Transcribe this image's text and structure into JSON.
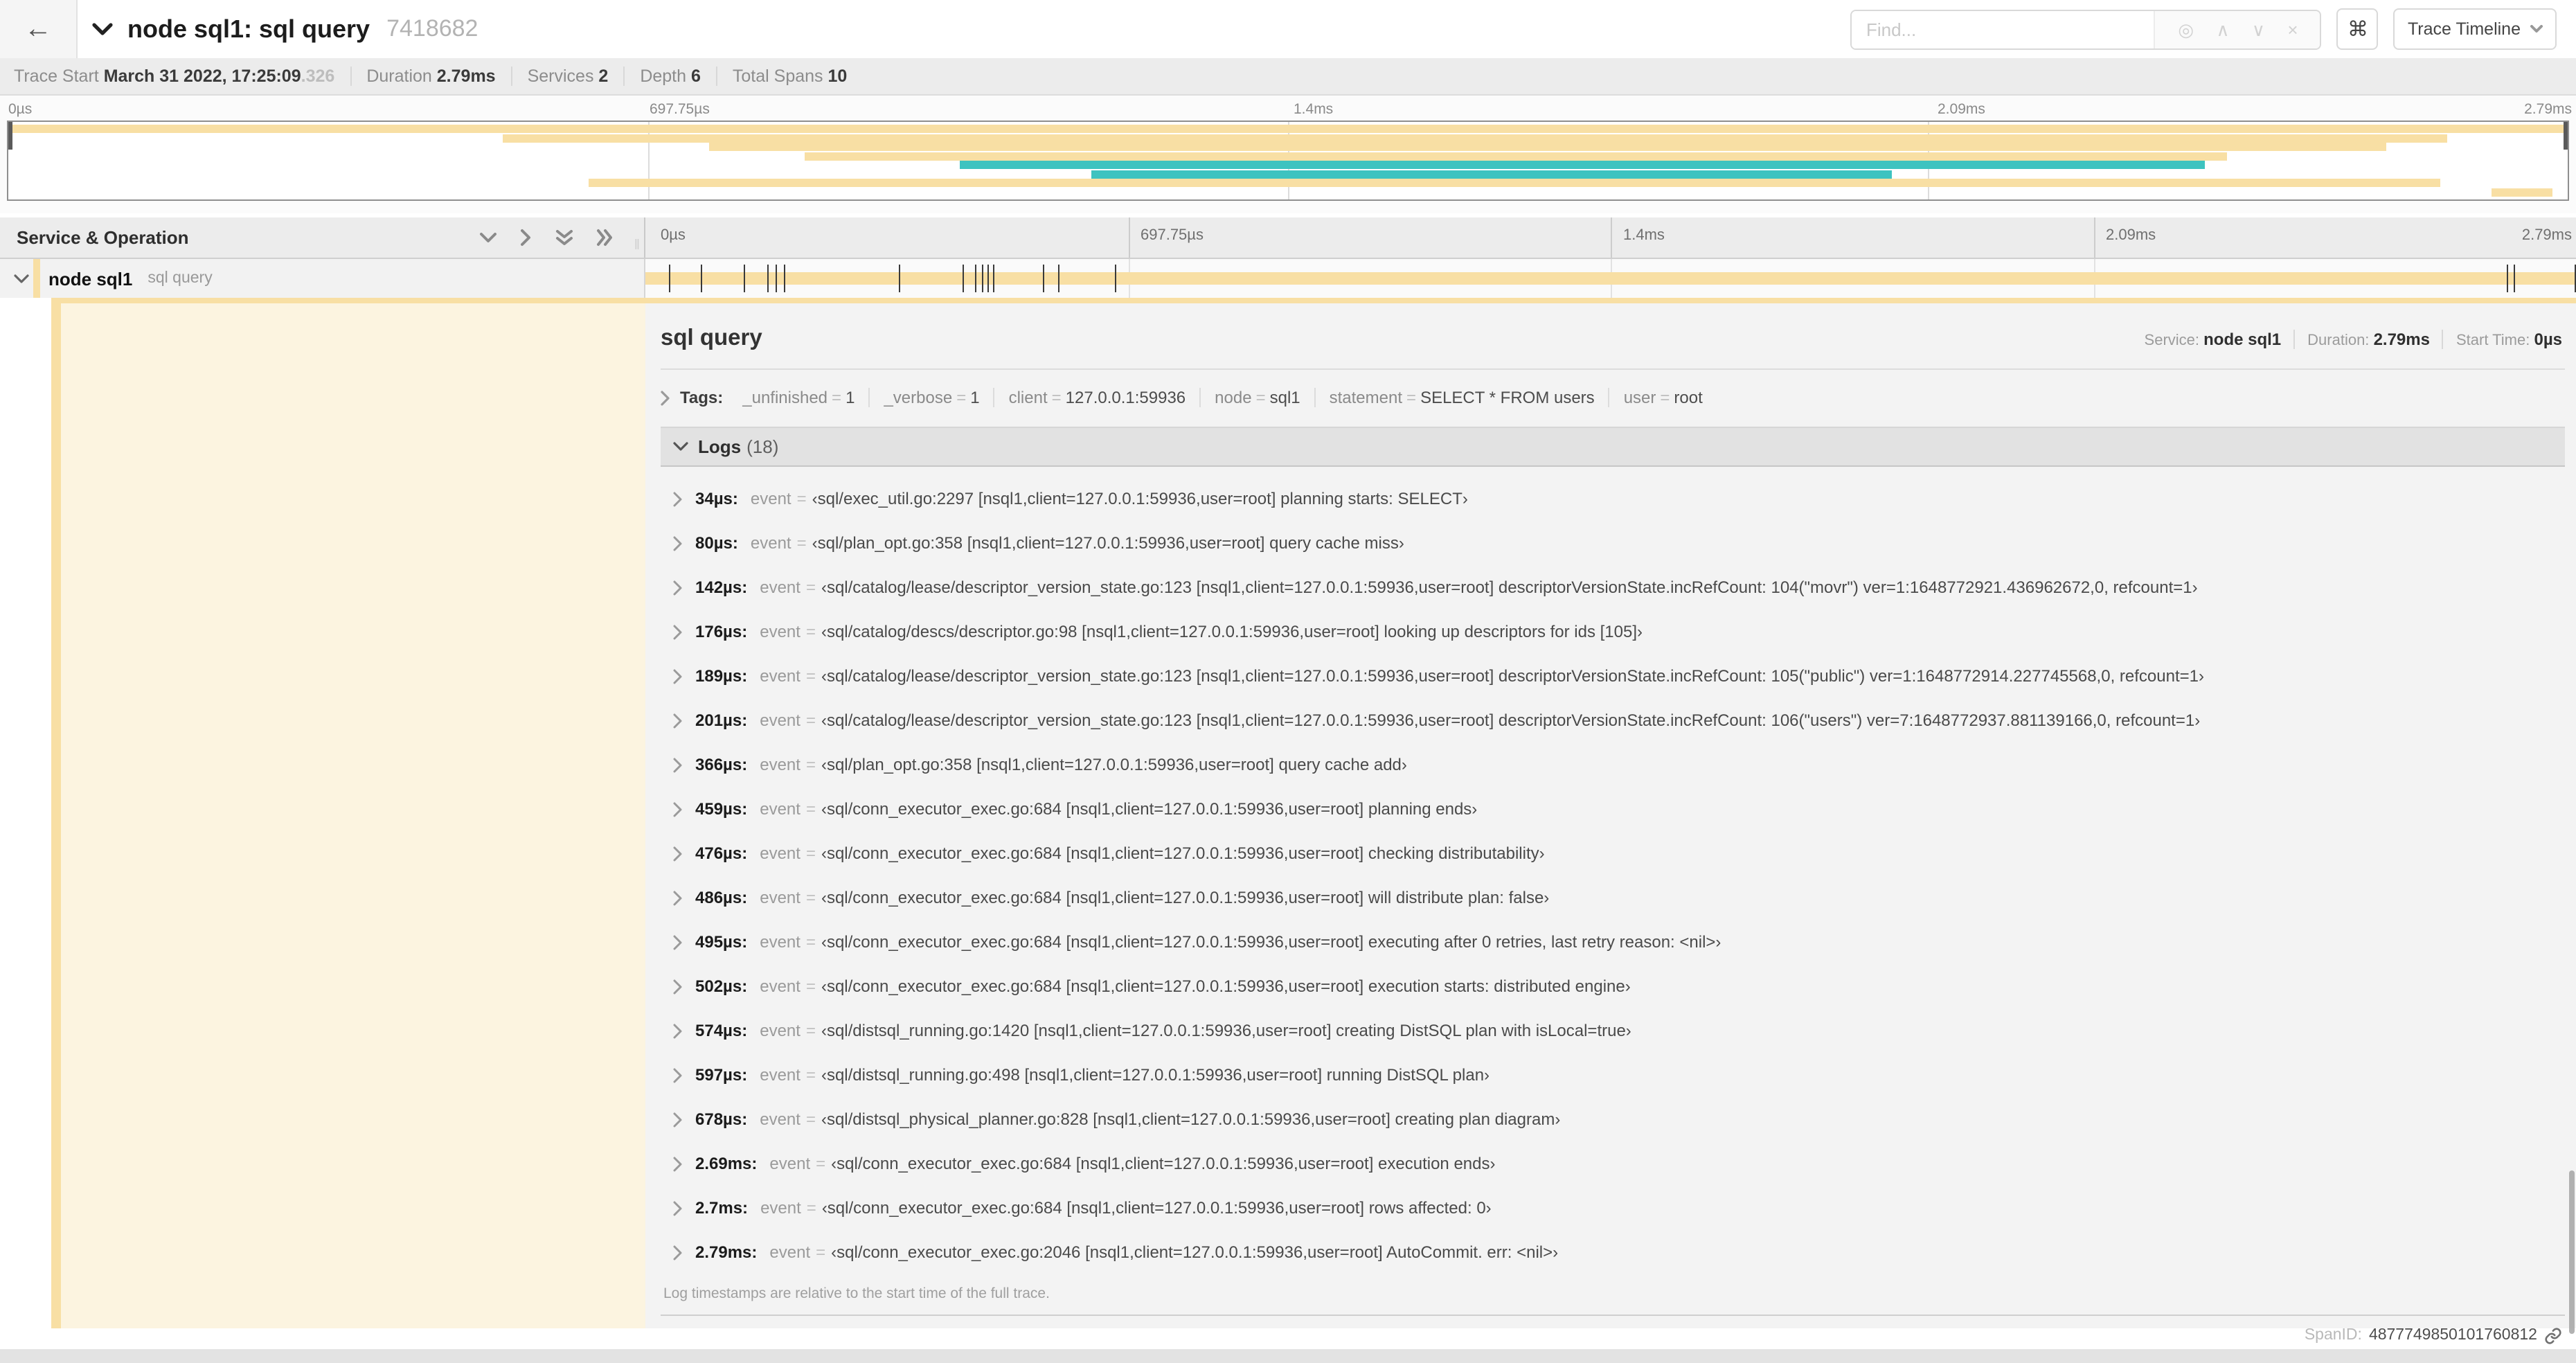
{
  "header": {
    "title": "node sql1: sql query",
    "trace_id": "7418682",
    "find_placeholder": "Find...",
    "shortcut_button": "⌘",
    "view_selector": "Trace Timeline",
    "back_arrow": "←",
    "find_icons": {
      "focus": "◎",
      "prev": "∧",
      "next": "∨",
      "clear": "×"
    }
  },
  "colors": {
    "span_tan": "#f8dfa4",
    "span_teal": "#3ec3c0"
  },
  "trace_meta": [
    {
      "label": "Trace Start",
      "value": "March 31 2022, 17:25:09",
      "dim": ".326"
    },
    {
      "label": "Duration",
      "value": "2.79ms"
    },
    {
      "label": "Services",
      "value": "2"
    },
    {
      "label": "Depth",
      "value": "6"
    },
    {
      "label": "Total Spans",
      "value": "10"
    }
  ],
  "time_ticks": [
    {
      "label": "0µs",
      "pct": 0
    },
    {
      "label": "697.75µs",
      "pct": 25
    },
    {
      "label": "1.4ms",
      "pct": 50
    },
    {
      "label": "2.09ms",
      "pct": 75
    },
    {
      "label": "2.79ms",
      "pct": 100
    }
  ],
  "minimap": {
    "spans": [
      {
        "row": 0,
        "start": 0,
        "end": 100,
        "color": "tan"
      },
      {
        "row": 1,
        "start": 19.3,
        "end": 95.3,
        "color": "tan"
      },
      {
        "row": 2,
        "start": 27.4,
        "end": 92.9,
        "color": "tan"
      },
      {
        "row": 3,
        "start": 31.1,
        "end": 86.7,
        "color": "tan"
      },
      {
        "row": 4,
        "start": 37.2,
        "end": 85.8,
        "color": "teal"
      },
      {
        "row": 5,
        "start": 42.3,
        "end": 73.6,
        "color": "teal"
      },
      {
        "row": 6,
        "start": 22.7,
        "end": 95.0,
        "color": "tan"
      },
      {
        "row": 7,
        "start": 97.0,
        "end": 99.4,
        "color": "tan"
      }
    ]
  },
  "grid_header": {
    "left_label": "Service & Operation"
  },
  "span_row": {
    "service": "node sql1",
    "operation": "sql query",
    "bar_start_pct": 0,
    "bar_end_pct": 100,
    "log_tick_pcts": [
      1.22,
      2.87,
      5.09,
      6.31,
      6.77,
      7.2,
      13.12,
      16.45,
      17.06,
      17.42,
      17.74,
      18.0,
      20.57,
      21.4,
      24.3,
      96.42,
      96.77,
      99.9
    ]
  },
  "detail": {
    "operation": "sql query",
    "meta": [
      {
        "label": "Service:",
        "value": "node sql1"
      },
      {
        "label": "Duration:",
        "value": "2.79ms"
      },
      {
        "label": "Start Time:",
        "value": "0µs"
      }
    ],
    "tags_label": "Tags:",
    "tags": [
      {
        "key": "_unfinished",
        "value": "1"
      },
      {
        "key": "_verbose",
        "value": "1"
      },
      {
        "key": "client",
        "value": "127.0.0.1:59936"
      },
      {
        "key": "node",
        "value": "sql1"
      },
      {
        "key": "statement",
        "value": "SELECT * FROM users"
      },
      {
        "key": "user",
        "value": "root"
      }
    ],
    "logs_label": "Logs",
    "logs_count": "(18)",
    "logs": [
      {
        "time": "34µs:",
        "key": "event",
        "value": "‹sql/exec_util.go:2297 [nsql1,client=127.0.0.1:59936,user=root] planning starts: SELECT›"
      },
      {
        "time": "80µs:",
        "key": "event",
        "value": "‹sql/plan_opt.go:358 [nsql1,client=127.0.0.1:59936,user=root] query cache miss›"
      },
      {
        "time": "142µs:",
        "key": "event",
        "value": "‹sql/catalog/lease/descriptor_version_state.go:123 [nsql1,client=127.0.0.1:59936,user=root] descriptorVersionState.incRefCount: 104(\"movr\") ver=1:1648772921.436962672,0, refcount=1›"
      },
      {
        "time": "176µs:",
        "key": "event",
        "value": "‹sql/catalog/descs/descriptor.go:98 [nsql1,client=127.0.0.1:59936,user=root] looking up descriptors for ids [105]›"
      },
      {
        "time": "189µs:",
        "key": "event",
        "value": "‹sql/catalog/lease/descriptor_version_state.go:123 [nsql1,client=127.0.0.1:59936,user=root] descriptorVersionState.incRefCount: 105(\"public\") ver=1:1648772914.227745568,0, refcount=1›"
      },
      {
        "time": "201µs:",
        "key": "event",
        "value": "‹sql/catalog/lease/descriptor_version_state.go:123 [nsql1,client=127.0.0.1:59936,user=root] descriptorVersionState.incRefCount: 106(\"users\") ver=7:1648772937.881139166,0, refcount=1›"
      },
      {
        "time": "366µs:",
        "key": "event",
        "value": "‹sql/plan_opt.go:358 [nsql1,client=127.0.0.1:59936,user=root] query cache add›"
      },
      {
        "time": "459µs:",
        "key": "event",
        "value": "‹sql/conn_executor_exec.go:684 [nsql1,client=127.0.0.1:59936,user=root] planning ends›"
      },
      {
        "time": "476µs:",
        "key": "event",
        "value": "‹sql/conn_executor_exec.go:684 [nsql1,client=127.0.0.1:59936,user=root] checking distributability›"
      },
      {
        "time": "486µs:",
        "key": "event",
        "value": "‹sql/conn_executor_exec.go:684 [nsql1,client=127.0.0.1:59936,user=root] will distribute plan: false›"
      },
      {
        "time": "495µs:",
        "key": "event",
        "value": "‹sql/conn_executor_exec.go:684 [nsql1,client=127.0.0.1:59936,user=root] executing after 0 retries, last retry reason: <nil>›"
      },
      {
        "time": "502µs:",
        "key": "event",
        "value": "‹sql/conn_executor_exec.go:684 [nsql1,client=127.0.0.1:59936,user=root] execution starts: distributed engine›"
      },
      {
        "time": "574µs:",
        "key": "event",
        "value": "‹sql/distsql_running.go:1420 [nsql1,client=127.0.0.1:59936,user=root] creating DistSQL plan with isLocal=true›"
      },
      {
        "time": "597µs:",
        "key": "event",
        "value": "‹sql/distsql_running.go:498 [nsql1,client=127.0.0.1:59936,user=root] running DistSQL plan›"
      },
      {
        "time": "678µs:",
        "key": "event",
        "value": "‹sql/distsql_physical_planner.go:828 [nsql1,client=127.0.0.1:59936,user=root] creating plan diagram›"
      },
      {
        "time": "2.69ms:",
        "key": "event",
        "value": "‹sql/conn_executor_exec.go:684 [nsql1,client=127.0.0.1:59936,user=root] execution ends›"
      },
      {
        "time": "2.7ms:",
        "key": "event",
        "value": "‹sql/conn_executor_exec.go:684 [nsql1,client=127.0.0.1:59936,user=root] rows affected: 0›"
      },
      {
        "time": "2.79ms:",
        "key": "event",
        "value": "‹sql/conn_executor_exec.go:2046 [nsql1,client=127.0.0.1:59936,user=root] AutoCommit. err: <nil>›"
      }
    ],
    "logs_footer": "Log timestamps are relative to the start time of the full trace.",
    "span_id_label": "SpanID:",
    "span_id": "4877749850101760812"
  }
}
